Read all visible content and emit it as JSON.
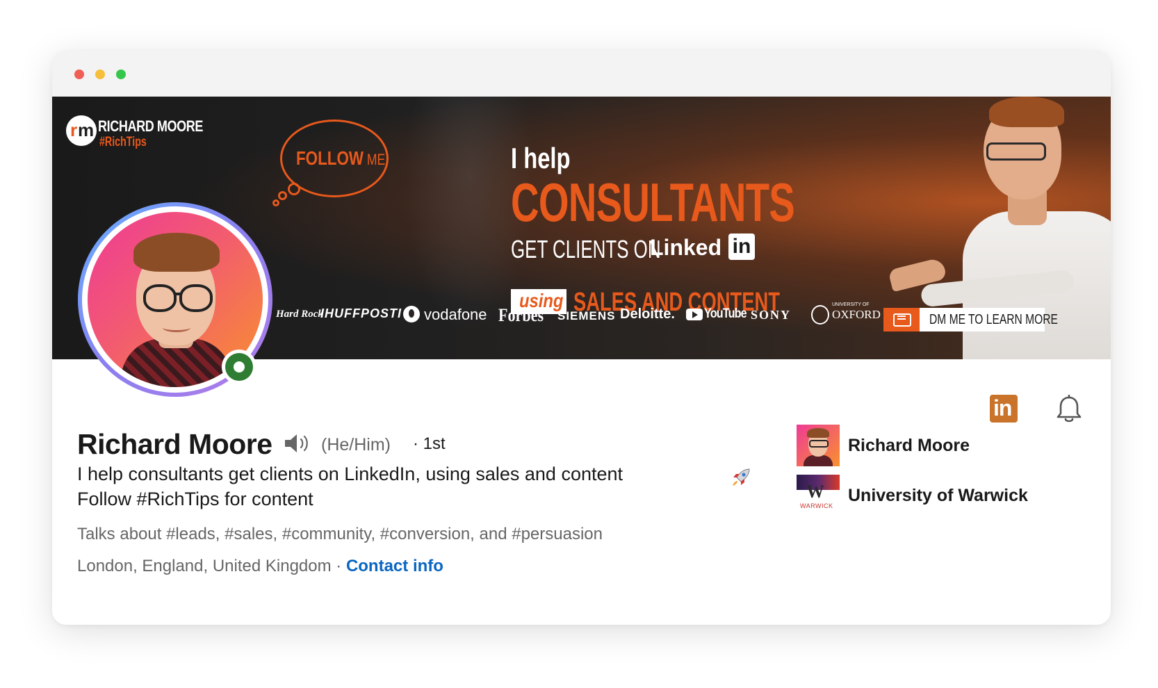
{
  "window": {
    "controls": [
      "close",
      "minimize",
      "maximize"
    ]
  },
  "banner": {
    "brand_name": "RICHARD MOORE",
    "brand_tag": "#RichTips",
    "bubble_follow": "FOLLOW",
    "bubble_me": "ME",
    "headline_intro": "I help",
    "headline_main": "CONSULTANTS",
    "headline_get_clients": "GET CLIENTS ON",
    "headline_linkedin_word": "Linked",
    "headline_linkedin_in": "in",
    "headline_using": "using",
    "headline_sales": "SALES AND CONTENT",
    "logos": {
      "hardrock": "Hard Rock",
      "huffpost": "IHUFFPOSTI",
      "vodafone": "vodafone",
      "forbes": "Forbes",
      "siemens": "SIEMENS",
      "deloitte": "Deloitte.",
      "youtube": "YouTube",
      "sony": "SONY",
      "oxford_small": "UNIVERSITY OF",
      "oxford": "OXFORD"
    },
    "dm_button": "DM ME TO LEARN MORE"
  },
  "profile": {
    "name": "Richard Moore",
    "pronouns": "(He/Him)",
    "degree": "· 1st",
    "headline_line1": "I help consultants get clients on LinkedIn, using sales and content",
    "headline_line2": "Follow #RichTips for content",
    "talks_about": "Talks about #leads, #sales, #community, #conversion, and #persuasion",
    "location": "London, England, United Kingdom",
    "location_separator": " · ",
    "contact_info": "Contact info"
  },
  "actions": {
    "linkedin_logo_text": "in"
  },
  "side_panel": {
    "items": [
      {
        "label": "Richard Moore"
      },
      {
        "label": "University of Warwick",
        "logo_text": "WARWICK"
      }
    ]
  },
  "colors": {
    "accent_orange": "#e8591c",
    "link_blue": "#0a66c2",
    "online_green": "#2e7d32",
    "linkedin_button": "#c9742a"
  },
  "icons": [
    "speaker-icon",
    "rocket-icon",
    "bell-icon",
    "linkedin-icon",
    "message-icon",
    "online-status-icon"
  ]
}
